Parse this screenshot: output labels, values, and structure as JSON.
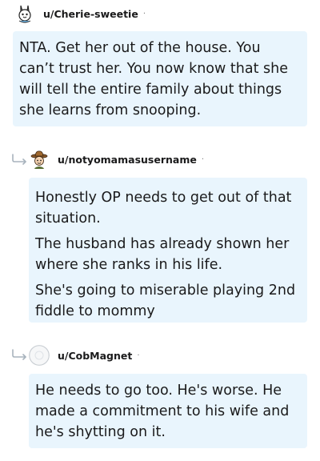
{
  "comments": [
    {
      "username": "u/Cherie-sweetie",
      "separator": "·",
      "avatar": "rabbit-avatar",
      "paragraphs": [
        "NTA. Get her out of the house. You can’t trust her. You now know that she will tell the entire family about things she learns from snooping."
      ]
    },
    {
      "username": "u/notyomamasusername",
      "separator": "·",
      "avatar": "cowboy-hat-avatar",
      "reply_icon": "reply-arrow-icon",
      "paragraphs": [
        "Honestly OP needs to get out of that situation.",
        "The husband has already shown her where she ranks in his life.",
        "She's going to miserable playing 2nd fiddle to mommy"
      ]
    },
    {
      "username": "u/CobMagnet",
      "separator": "·",
      "avatar": "default-avatar",
      "reply_icon": "reply-arrow-icon",
      "paragraphs": [
        "He needs to go too. He's worse. He made a commitment to his wife and he's shytting on it."
      ]
    }
  ],
  "colors": {
    "bubble_bg": "#e9f5fd",
    "text": "#1a1a1b",
    "muted": "#7c7c7c",
    "reply_arrow": "#a8b3bd"
  }
}
